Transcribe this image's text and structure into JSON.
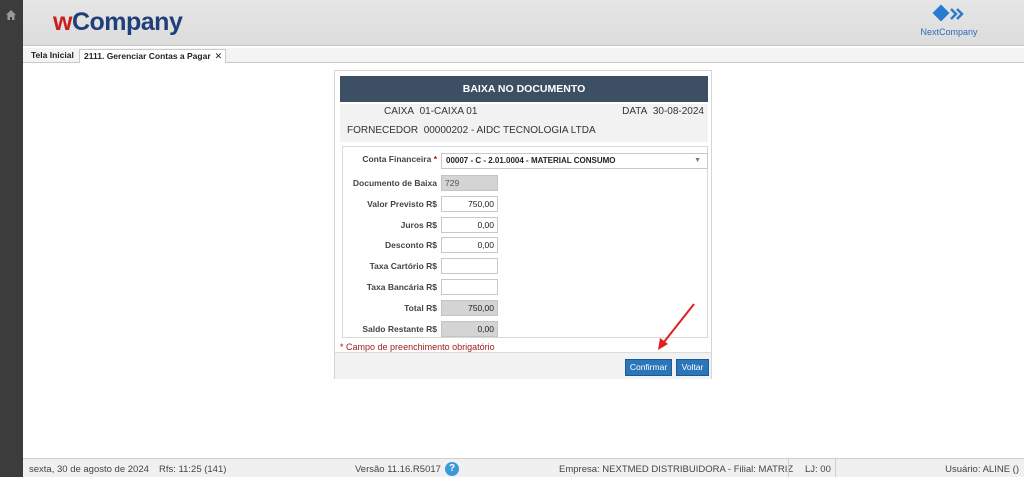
{
  "header": {
    "logo_w": "w",
    "logo_company": "Company",
    "nextcompany_label": "NextCompany"
  },
  "tabs": [
    {
      "label": "Tela Inicial"
    },
    {
      "label": "2111. Gerenciar Contas a Pagar",
      "close": "✕"
    }
  ],
  "dialog": {
    "title": "BAIXA NO DOCUMENTO",
    "caixa_label": "CAIXA",
    "caixa_value": "01-CAIXA 01",
    "data_label": "DATA",
    "data_value": "30-08-2024",
    "fornecedor_label": "FORNECEDOR",
    "fornecedor_value": "00000202 - AIDC TECNOLOGIA LTDA",
    "fields": {
      "conta_financeira_label": "Conta Financeira",
      "conta_financeira_required": "*",
      "conta_financeira_value": "00007 - C - 2.01.0004 - MATERIAL CONSUMO",
      "documento_baixa_label": "Documento de Baixa",
      "documento_baixa_value": "729",
      "valor_previsto_label": "Valor Previsto R$",
      "valor_previsto_value": "750,00",
      "juros_label": "Juros R$",
      "juros_value": "0,00",
      "desconto_label": "Desconto R$",
      "desconto_value": "0,00",
      "taxa_cartorio_label": "Taxa Cartório R$",
      "taxa_cartorio_value": "",
      "taxa_bancaria_label": "Taxa Bancária R$",
      "taxa_bancaria_value": "",
      "total_label": "Total R$",
      "total_value": "750,00",
      "saldo_restante_label": "Saldo Restante R$",
      "saldo_restante_value": "0,00"
    },
    "required_note_mark": "*",
    "required_note": "Campo de preenchimento obrigatório",
    "confirm_label": "Confirmar",
    "back_label": "Voltar"
  },
  "status": {
    "date": "sexta, 30 de agosto de 2024",
    "rfs": "Rfs: 11:25 (141)",
    "version": "Versão 11.16.R5017",
    "help": "?",
    "empresa": "Empresa: NEXTMED DISTRIBUIDORA - Filial: MATRIZ",
    "lj": "LJ: 00",
    "usuario": "Usuário: ALINE ()"
  },
  "colors": {
    "title_bar": "#3d4f63",
    "button": "#2b76b9",
    "annotation_arrow": "#e02020",
    "logo_w": "#cc1e1e",
    "logo_company": "#1e3f7a"
  },
  "icons": [
    "home-icon",
    "nextcompany-logo-icon",
    "close-icon",
    "dropdown-caret-icon",
    "help-icon",
    "annotation-arrow"
  ]
}
